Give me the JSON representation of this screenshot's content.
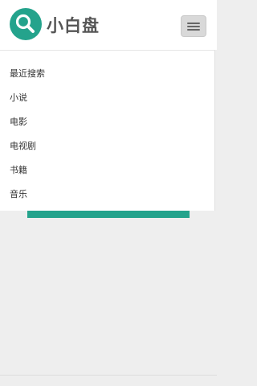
{
  "header": {
    "brand": "小白盘",
    "logo_icon": "search-icon",
    "menu_icon": "hamburger-menu-icon",
    "accent_color": "#24a38c"
  },
  "menu": {
    "items": [
      {
        "label": "最近搜索"
      },
      {
        "label": "小说"
      },
      {
        "label": "电影"
      },
      {
        "label": "电视剧"
      },
      {
        "label": "书籍"
      },
      {
        "label": "音乐"
      }
    ]
  }
}
